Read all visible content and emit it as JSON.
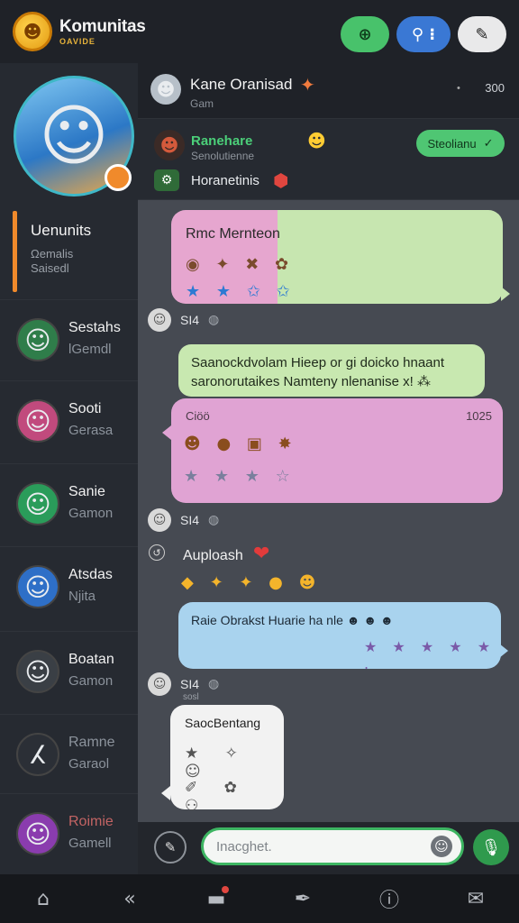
{
  "app": {
    "brand": "Komunitas",
    "brand_sub": "OAVIDE"
  },
  "top_actions": [
    {
      "icon": "add-circle-icon",
      "glyph": "⊕"
    },
    {
      "icon": "location-pin-icon",
      "glyph": "⚲ ⁝"
    },
    {
      "icon": "edit-icon",
      "glyph": "✎"
    }
  ],
  "sidebar": {
    "active": {
      "title": "Uenunits",
      "subtitle1": "Ωemalis",
      "subtitle2": "Saisedl"
    },
    "items": [
      {
        "name": "Sestahs",
        "status": "lGemdl",
        "avatar_bg": "#2f7d4a",
        "glyph": "☺"
      },
      {
        "name": "Sooti",
        "status": "Gerasa",
        "avatar_bg": "#c14a7d",
        "glyph": "☺"
      },
      {
        "name": "Sanie",
        "status": "Gamon",
        "avatar_bg": "#2a9c5a",
        "glyph": "☺"
      },
      {
        "name": "Atsdas",
        "status": "Njita",
        "avatar_bg": "#2e6fc7",
        "glyph": "☺"
      },
      {
        "name": "Boatan",
        "status": "Gamon",
        "avatar_bg": "#3a3f45",
        "glyph": "☺"
      },
      {
        "name": "Ramne",
        "status": "Garaol",
        "avatar_bg": "#2b2f36",
        "glyph": "ⵃ"
      },
      {
        "name": "Roimie",
        "status": "Gamell",
        "avatar_bg": "#8a3cae",
        "glyph": "☺"
      }
    ]
  },
  "chat_header": {
    "name": "Kane Oranisad",
    "status": "Gam",
    "time": "300"
  },
  "pinned": {
    "name": "Ranehare",
    "subtitle": "Senolutienne",
    "button_label": "Steolianu",
    "topic": "Horanetinis"
  },
  "messages": {
    "m1": {
      "title": "Rmc Mernteon",
      "emojis": "◉ ✦ ✖ ✿",
      "stars": "★ ★ ✩ ✩"
    },
    "meta1": {
      "sender": "SI4",
      "sub": "",
      "icon": "◍"
    },
    "m2": {
      "text": "Saanockdvolam Hieep or gi doicko hnaant saronorutaikes Namteny nlenanise x! ⁂"
    },
    "m3": {
      "header": "Ciöö",
      "time": "1025",
      "emojis": "☻ ● ▣ ✸",
      "stars": "★ ★ ★ ☆"
    },
    "meta2": {
      "sender": "SI4",
      "sub": "",
      "icon": "◍"
    },
    "plain": {
      "text": "Auploash",
      "heart": "❤",
      "emojis": "◆ ✦ ✦ ● ☻"
    },
    "m4": {
      "text": "Raie Obrakst Huarie ha nle ☻ ☻ ☻",
      "stars": "★ ★ ★ ★ ★ ."
    },
    "meta3": {
      "sender": "SI4",
      "sub": "sosl",
      "icon": "◍"
    },
    "m5": {
      "title": "SaocBentang",
      "row1": "★ ✧ ☺",
      "row2": "✐ ✿ ⚇"
    }
  },
  "composer": {
    "placeholder": "Inacghet."
  },
  "bottom_nav": [
    {
      "icon": "home-icon",
      "glyph": "⌂"
    },
    {
      "icon": "back-icon",
      "glyph": "«"
    },
    {
      "icon": "notifications-icon",
      "glyph": "▬"
    },
    {
      "icon": "feather-icon",
      "glyph": "✒"
    },
    {
      "icon": "info-icon",
      "glyph": "ⓘ"
    },
    {
      "icon": "chat-icon",
      "glyph": "✉"
    }
  ],
  "colors": {
    "accent_green": "#48c26b",
    "accent_blue": "#3a78d4",
    "accent_orange": "#f08a2b"
  }
}
